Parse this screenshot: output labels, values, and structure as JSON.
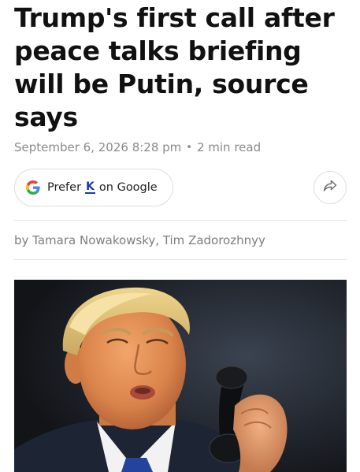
{
  "article": {
    "headline": "Trump's first call after peace talks briefing will be Putin, source says",
    "date": "September 6, 2026 8:28 pm",
    "separator": "•",
    "read_time": "2 min read",
    "byline": "by Tamara Nowakowsky, Tim Zadorozhnyy"
  },
  "prefer_button": {
    "prefix": "Prefer",
    "brand_letter": "K",
    "suffix": "on Google",
    "icon": "google-g-icon"
  },
  "share_button": {
    "icon": "share-arrow-icon"
  },
  "photo": {
    "subject": "man in suit holding a telephone handset"
  },
  "colors": {
    "headline": "#111111",
    "meta": "#8a8a8a",
    "brand_blue": "#1a3aa8",
    "divider": "#e3e3e3"
  }
}
